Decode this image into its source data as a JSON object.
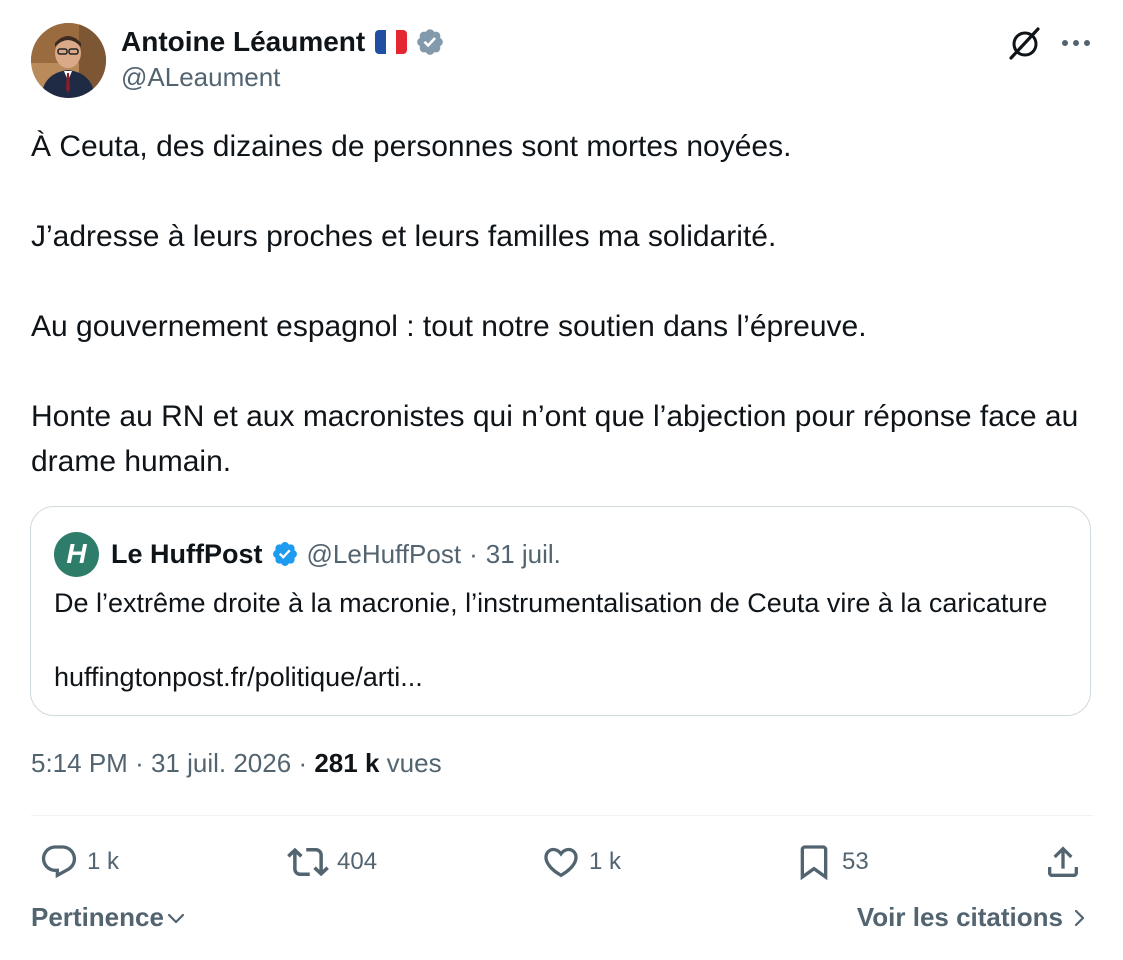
{
  "author": {
    "name": "Antoine Léaument",
    "handle": "@ALeaument",
    "flag": "france-flag",
    "verified_color": "#829aab"
  },
  "header_icons": {
    "grok": "grok-icon",
    "more": "more-icon"
  },
  "tweet": {
    "paragraphs": [
      "À Ceuta, des dizaines de personnes sont mortes noyées.",
      "J’adresse à leurs proches et leurs familles ma solidarité.",
      "Au gouvernement espagnol : tout notre soutien dans l’épreuve.",
      "Honte au RN et aux macronistes qui n’ont que l’abjection pour réponse face au drame humain."
    ]
  },
  "quote": {
    "logo_letter": "H",
    "logo_color": "#2e7d6a",
    "name": "Le HuffPost",
    "verified_color": "#1d9bf0",
    "handle": "@LeHuffPost",
    "separator": "·",
    "date": "31 juil.",
    "text": "De l’extrême droite à la macronie, l’instrumentalisation de Ceuta vire à la caricature",
    "link": "huffingtonpost.fr/politique/arti..."
  },
  "meta": {
    "time": "5:14 PM",
    "sep1": "·",
    "date": "31 juil. 2026",
    "sep2": "·",
    "views_count": "281 k",
    "views_label": "vues"
  },
  "actions": {
    "reply_count": "1 k",
    "retweet_count": "404",
    "like_count": "1 k",
    "bookmark_count": "53"
  },
  "footer": {
    "sort_label": "Pertinence",
    "quotes_label": "Voir les citations"
  },
  "colors": {
    "text": "#0f1419",
    "secondary": "#536471",
    "border": "#cfd9de",
    "divider": "#eff3f4"
  }
}
